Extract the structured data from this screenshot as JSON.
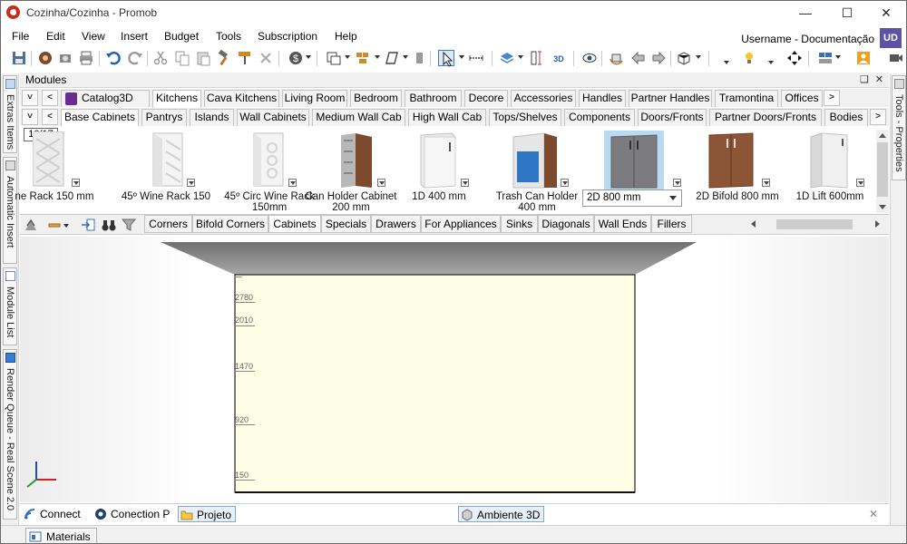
{
  "window": {
    "title": "Cozinha/Cozinha - Promob",
    "minimize": "—",
    "maximize": "☐",
    "close": "✕"
  },
  "menu": {
    "items": [
      "File",
      "Edit",
      "View",
      "Insert",
      "Budget",
      "Tools",
      "Subscription",
      "Help"
    ],
    "username": "Username - Documentação",
    "avatar": "UD"
  },
  "left_rail": {
    "tabs": [
      "Extras Items",
      "Automatic Insert",
      "Module List",
      "Render Queue - Real Scene 2.0"
    ]
  },
  "right_rail": {
    "tabs": [
      "Tools - Properties"
    ]
  },
  "modules": {
    "title": "Modules",
    "pin": "❑",
    "close": "✕",
    "nav_down": "˅",
    "nav_left": "<",
    "nav_right": ">",
    "catalog_label": "Catalog3D",
    "category_tabs": [
      "Kitchens",
      "Cava Kitchens",
      "Living Room",
      "Bedroom",
      "Bathroom",
      "Decore",
      "Accessories",
      "Handles",
      "Partner Handles",
      "Tramontina",
      "Offices"
    ],
    "group_tabs": [
      "Base Cabinets",
      "Pantrys",
      "Islands",
      "Wall Cabinets",
      "Medium Wall Cab",
      "High Wall Cab",
      "Tops/Shelves",
      "Components",
      "Doors/Fronts",
      "Partner Doors/Fronts",
      "Bodies"
    ],
    "page_counter": "10/17",
    "items": [
      {
        "label": "ne Rack 150 mm"
      },
      {
        "label": "45º Wine Rack 150"
      },
      {
        "label": "45º Circ Wine Rack\n150mm"
      },
      {
        "label": "Can Holder Cabinet\n200 mm"
      },
      {
        "label": "1D 400 mm"
      },
      {
        "label": "Trash Can Holder\n400 mm"
      },
      {
        "label": "2D 800 mm"
      },
      {
        "label": "2D Bifold 800 mm"
      },
      {
        "label": "1D Lift 600mm"
      }
    ],
    "selected_item": "2D 800 mm",
    "sub_tabs": [
      "Corners",
      "Bifold Corners",
      "Cabinets",
      "Specials",
      "Drawers",
      "For Appliances",
      "Sinks",
      "Diagonals",
      "Wall Ends",
      "Fillers"
    ],
    "active_sub_tab": "Cabinets"
  },
  "viewport": {
    "ruler_labels": [
      "2780",
      "2010",
      "1470",
      "920",
      "150"
    ]
  },
  "bottom_bar": {
    "items": [
      "Connect",
      "Conection P",
      "Projeto"
    ],
    "view_tab": "Ambiente 3D",
    "close": "✕"
  },
  "status_bar": {
    "materials": "Materials"
  }
}
